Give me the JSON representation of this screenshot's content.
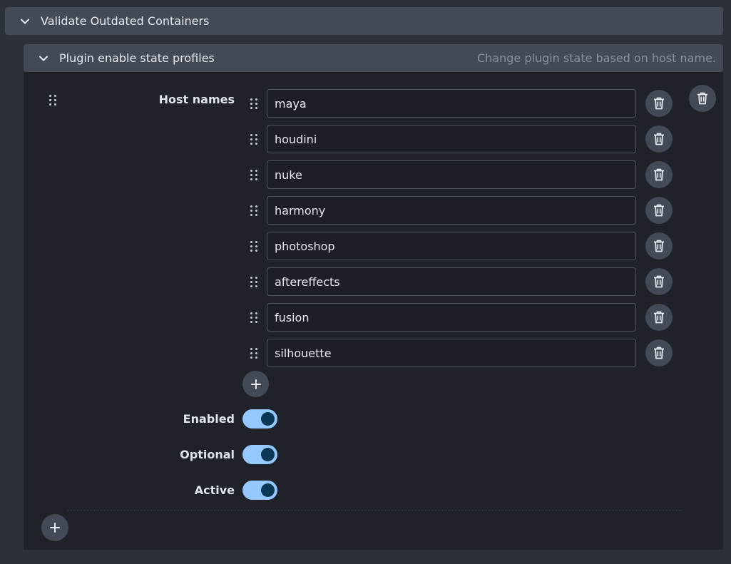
{
  "panel": {
    "title": "Validate Outdated Containers",
    "expand_icon": "chevron-down-icon"
  },
  "profiles": {
    "title": "Plugin enable state profiles",
    "description": "Change plugin state based on host name.",
    "expand_icon": "chevron-down-icon"
  },
  "profile": {
    "host_names_label": "Host names",
    "host_names": [
      "maya",
      "houdini",
      "nuke",
      "harmony",
      "photoshop",
      "aftereffects",
      "fusion",
      "silhouette"
    ],
    "enabled_label": "Enabled",
    "enabled": true,
    "optional_label": "Optional",
    "optional": true,
    "active_label": "Active",
    "active": true
  },
  "icons": {
    "drag": "drag-handle-icon",
    "delete": "trash-icon",
    "add": "plus-icon"
  },
  "colors": {
    "header_bg": "#434a56",
    "content_bg": "#1f2228",
    "toggle_on": "#94c8ff",
    "toggle_knob": "#0b3756"
  }
}
